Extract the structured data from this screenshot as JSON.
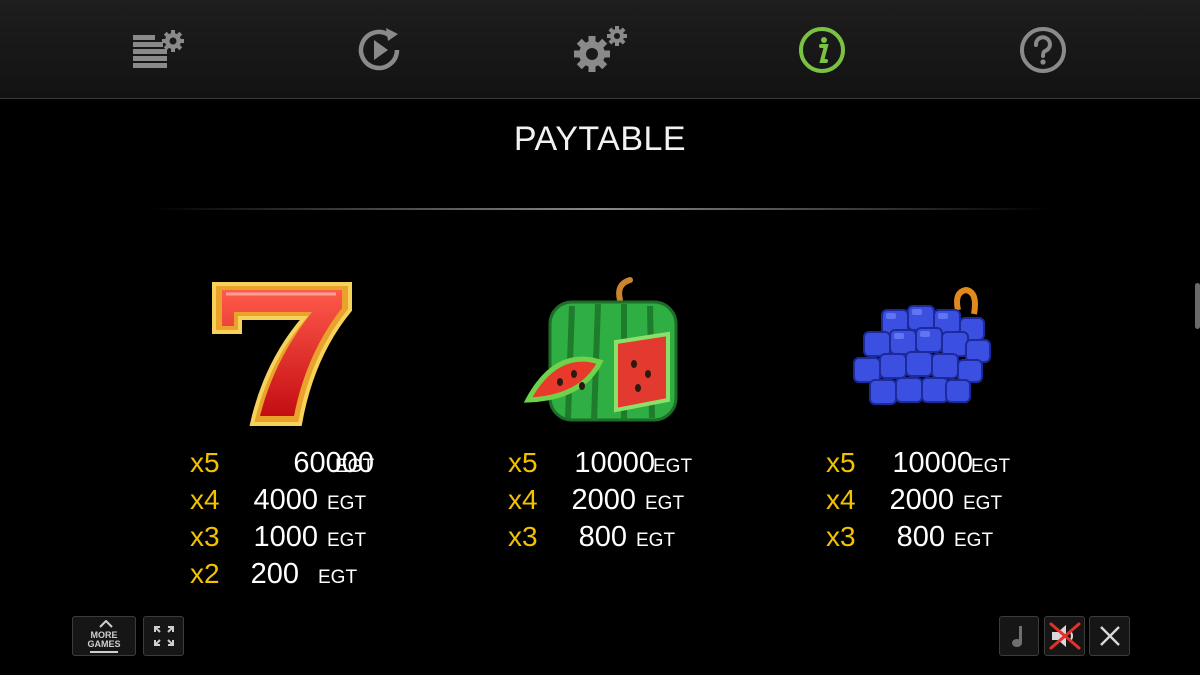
{
  "toolbar": {
    "icons": [
      "history-settings-icon",
      "autoplay-icon",
      "settings-icon",
      "info-icon",
      "help-icon"
    ],
    "active": "info-icon",
    "active_color": "#7bc142"
  },
  "title": "PAYTABLE",
  "symbols": [
    {
      "name": "seven",
      "payouts": [
        {
          "mult": "x5",
          "amount": "60000",
          "unit": "EGT"
        },
        {
          "mult": "x4",
          "amount": "4000",
          "unit": "EGT"
        },
        {
          "mult": "x3",
          "amount": "1000",
          "unit": "EGT"
        },
        {
          "mult": "x2",
          "amount": "200",
          "unit": "EGT"
        }
      ]
    },
    {
      "name": "watermelon",
      "payouts": [
        {
          "mult": "x5",
          "amount": "10000",
          "unit": "EGT"
        },
        {
          "mult": "x4",
          "amount": "2000",
          "unit": "EGT"
        },
        {
          "mult": "x3",
          "amount": "800",
          "unit": "EGT"
        }
      ]
    },
    {
      "name": "grapes",
      "payouts": [
        {
          "mult": "x5",
          "amount": "10000",
          "unit": "EGT"
        },
        {
          "mult": "x4",
          "amount": "2000",
          "unit": "EGT"
        },
        {
          "mult": "x3",
          "amount": "800",
          "unit": "EGT"
        }
      ]
    }
  ],
  "bottom": {
    "more_games": [
      "MORE",
      "GAMES"
    ],
    "icons": [
      "fullscreen-icon",
      "music-icon",
      "sound-muted-icon",
      "close-icon"
    ]
  },
  "colors": {
    "multiplier": "#f2c200",
    "text": "#ffffff",
    "background": "#000000"
  }
}
